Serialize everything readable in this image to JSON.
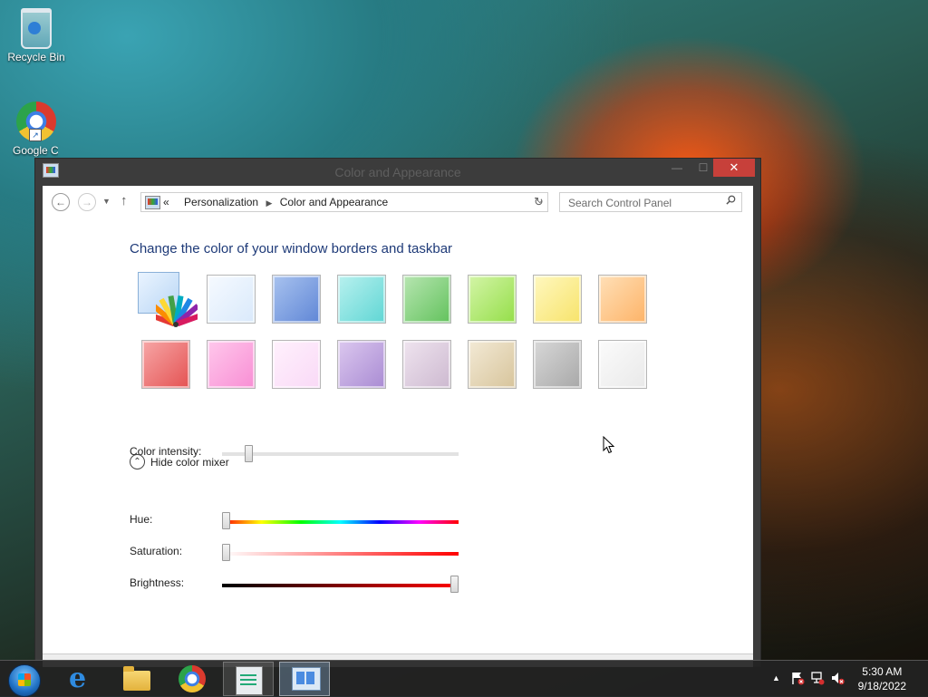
{
  "desktop": {
    "icons": [
      {
        "label": "Recycle Bin",
        "icon": "recycle-bin-icon"
      },
      {
        "label": "Google Chrome",
        "icon": "chrome-icon"
      }
    ]
  },
  "window": {
    "title": "Color and Appearance",
    "controls": {
      "minimize": "—",
      "maximize": "☐",
      "close": "✕"
    }
  },
  "navbar": {
    "breadcrumb": {
      "overflow": "«",
      "items": [
        "Personalization",
        "Color and Appearance"
      ]
    },
    "search_placeholder": "Search Control Panel"
  },
  "content": {
    "heading": "Change the color of your window borders and taskbar",
    "swatches_row1": [
      {
        "name": "sky",
        "color_top": "#f6faff",
        "color_bottom": "#d9e9fb"
      },
      {
        "name": "twilight",
        "color_top": "#a9c3ef",
        "color_bottom": "#5f86d6"
      },
      {
        "name": "sea-foam",
        "color_top": "#b9f1ef",
        "color_bottom": "#5fd6d4"
      },
      {
        "name": "leaf",
        "color_top": "#b8e6b2",
        "color_bottom": "#62c25c"
      },
      {
        "name": "lime",
        "color_top": "#d4f5a8",
        "color_bottom": "#94de48"
      },
      {
        "name": "sun",
        "color_top": "#fff8c0",
        "color_bottom": "#f7e36a"
      },
      {
        "name": "pumpkin",
        "color_top": "#ffe0b8",
        "color_bottom": "#fdb367"
      }
    ],
    "swatches_row2": [
      {
        "name": "blush",
        "color_top": "#f7a7a7",
        "color_bottom": "#e45252"
      },
      {
        "name": "bubblegum",
        "color_top": "#ffc8ec",
        "color_bottom": "#f88ed4"
      },
      {
        "name": "lavender",
        "color_top": "#fff1fd",
        "color_bottom": "#f9d9f6"
      },
      {
        "name": "violet",
        "color_top": "#dcc8ef",
        "color_bottom": "#a98bd3"
      },
      {
        "name": "dusk",
        "color_top": "#efe4ef",
        "color_bottom": "#cdb9d0"
      },
      {
        "name": "taupe",
        "color_top": "#f3ead6",
        "color_bottom": "#d7c49b"
      },
      {
        "name": "slate",
        "color_top": "#d8d8d8",
        "color_bottom": "#a8a8a8"
      },
      {
        "name": "frost",
        "color_top": "#fbfbfb",
        "color_bottom": "#e9e9e9"
      }
    ],
    "intensity": {
      "label": "Color intensity:",
      "value_fraction": 0.1
    },
    "mixer_toggle": {
      "label": "Hide color mixer",
      "icon": "chevron-up-icon"
    },
    "hue": {
      "label": "Hue:",
      "value_fraction": 0.0
    },
    "saturation": {
      "label": "Saturation:",
      "value_fraction": 0.0
    },
    "brightness": {
      "label": "Brightness:",
      "value_fraction": 1.0
    }
  },
  "taskbar": {
    "apps": [
      {
        "name": "start",
        "icon": "windows-logo-icon"
      },
      {
        "name": "internet-explorer",
        "icon": "ie-icon"
      },
      {
        "name": "file-explorer",
        "icon": "folder-icon"
      },
      {
        "name": "chrome",
        "icon": "chrome-icon"
      },
      {
        "name": "task-manager",
        "icon": "task-manager-icon"
      },
      {
        "name": "control-panel",
        "icon": "control-panel-icon"
      }
    ],
    "tray": {
      "overflow": "▲",
      "time": "5:30 AM",
      "date": "9/18/2022"
    }
  }
}
